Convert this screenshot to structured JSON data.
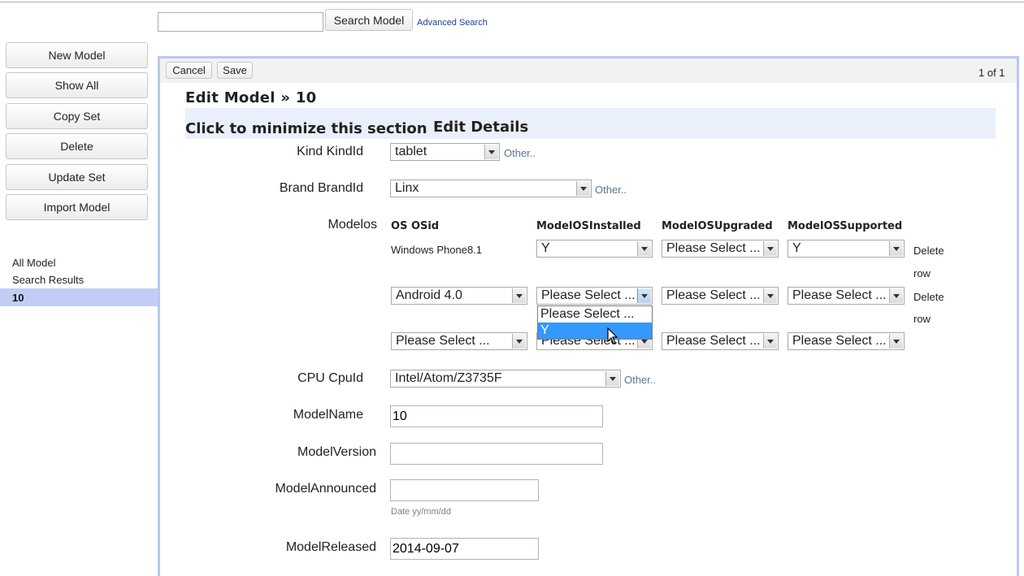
{
  "search": {
    "value": "",
    "button": "Search Model",
    "advanced": "Advanced Search"
  },
  "sidebar": {
    "buttons": [
      "New Model",
      "Show All",
      "Copy Set",
      "Delete",
      "Update Set",
      "Import Model"
    ],
    "links": [
      "All Model",
      "Search Results"
    ],
    "selected": "10"
  },
  "toolbar": {
    "cancel": "Cancel",
    "save": "Save",
    "pager": "1 of 1"
  },
  "page": {
    "title": "Edit Model » 10",
    "section_minimize": "Click to minimize this section",
    "section_title": "Edit Details"
  },
  "form": {
    "kind": {
      "label": "Kind KindId",
      "value": "tablet",
      "other": "Other.."
    },
    "brand": {
      "label": "Brand BrandId",
      "value": "Linx",
      "other": "Other.."
    },
    "modelos": {
      "label": "Modelos",
      "headers": [
        "OS OSid",
        "ModelOSInstalled",
        "ModelOSUpgraded",
        "ModelOSSupported"
      ],
      "rows": [
        {
          "os": "Windows Phone8.1",
          "installed": "Y",
          "upgraded": "Please Select ...",
          "supported": "Y",
          "delete1": "Delete",
          "delete2": "row"
        },
        {
          "os": "Android 4.0",
          "installed": "Please Select ...",
          "upgraded": "Please Select ...",
          "supported": "Please Select ...",
          "delete1": "Delete",
          "delete2": "row"
        },
        {
          "os": "Please Select ...",
          "installed": "Please Select ...",
          "upgraded": "Please Select ...",
          "supported": "Please Select ..."
        }
      ],
      "dropdown_options": [
        "Please Select ...",
        "Y"
      ],
      "dropdown_highlighted": "Y"
    },
    "cpu": {
      "label": "CPU CpuId",
      "value": "Intel/Atom/Z3735F",
      "other": "Other.."
    },
    "model_name": {
      "label": "ModelName",
      "value": "10"
    },
    "model_version": {
      "label": "ModelVersion",
      "value": ""
    },
    "model_announced": {
      "label": "ModelAnnounced",
      "value": "",
      "hint": "Date yy/mm/dd"
    },
    "model_released": {
      "label": "ModelReleased",
      "value": "2014-09-07"
    }
  }
}
